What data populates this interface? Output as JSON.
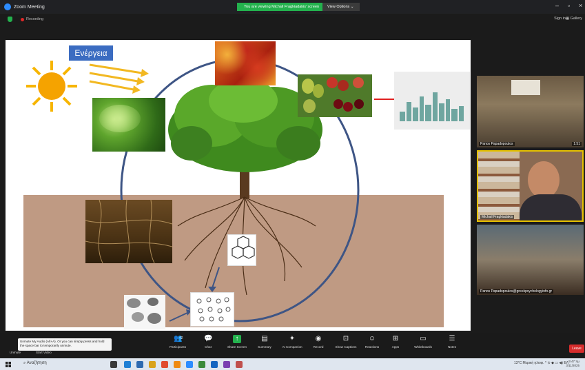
{
  "window": {
    "title": "Zoom Meeting",
    "share_banner": "You are viewing Michail Fragkiadakis' screen",
    "view_options": "View Options",
    "recording": "Recording",
    "sign_in": "Sign in",
    "gallery": "Gallery"
  },
  "slide": {
    "energy_label": "Ενέργεια"
  },
  "participants": [
    {
      "name": "Panos Papadopoulos",
      "extra": "1:51"
    },
    {
      "name": "Michail Fragkiadakis"
    },
    {
      "name": "Panos Papadopoulos@greekpsychologyinfo.gr"
    }
  ],
  "toolbar": {
    "tooltip": "Unmute My Audio (Alt+A). Or you can simply press and hold the space bar to temporarily unmute.",
    "unmute": "Unmute",
    "start_video": "Start Video",
    "items": [
      {
        "label": "Participants",
        "count": "42",
        "icon": "participants-icon"
      },
      {
        "label": "Chat",
        "icon": "chat-icon"
      },
      {
        "label": "Share Screen",
        "icon": "share-screen-icon"
      },
      {
        "label": "Summary",
        "icon": "summary-icon"
      },
      {
        "label": "AI Companion",
        "icon": "ai-companion-icon"
      },
      {
        "label": "Record",
        "icon": "record-icon"
      },
      {
        "label": "Show Captions",
        "icon": "captions-icon"
      },
      {
        "label": "Reactions",
        "icon": "reactions-icon"
      },
      {
        "label": "Apps",
        "icon": "apps-icon"
      },
      {
        "label": "Whiteboards",
        "icon": "whiteboard-icon"
      },
      {
        "label": "Notes",
        "icon": "notes-icon"
      }
    ],
    "leave": "Leave"
  },
  "taskbar": {
    "search": "Αναζήτηση",
    "weather": "13°C",
    "weather_text": "Μερική ηλιοφ.",
    "lang": "ΕΛ",
    "time": "9:47 πμ",
    "date": "3/11/2025"
  },
  "colors": {
    "share_green": "#23b14d",
    "leave_red": "#d62c2c",
    "energy_blue": "#3b6cc1",
    "ground_brown": "#bf9a83",
    "cycle_blue": "#3e5585"
  }
}
